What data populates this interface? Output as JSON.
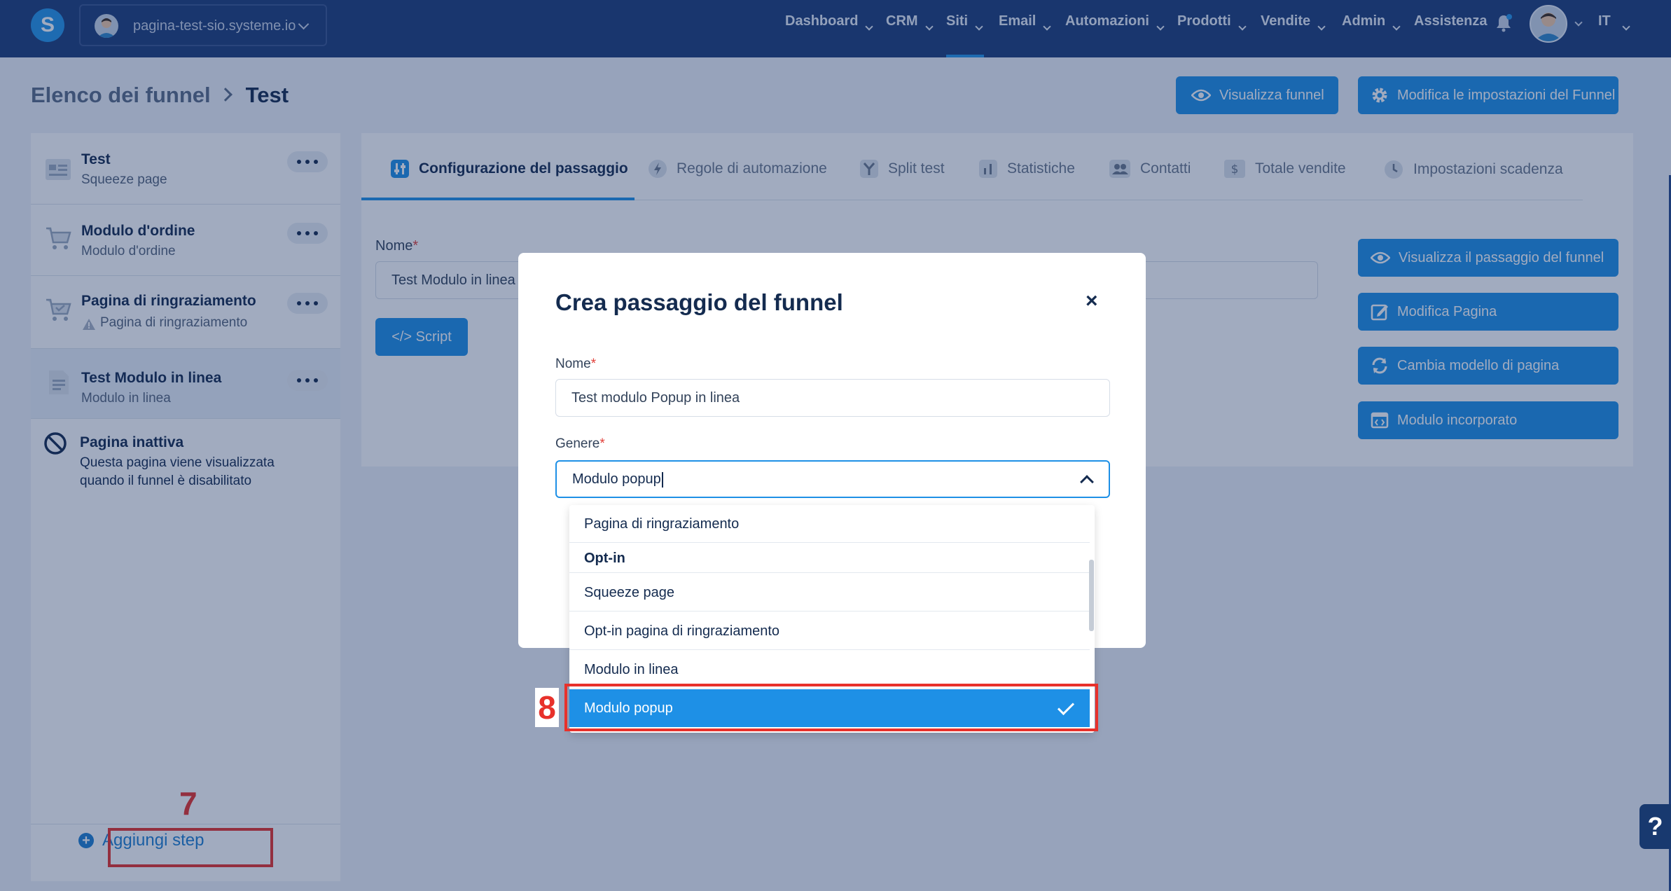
{
  "nav": {
    "logo": "S",
    "site_name": "pagina-test-sio.systeme.io",
    "menu": [
      {
        "label": "Dashboard"
      },
      {
        "label": "CRM"
      },
      {
        "label": "Siti"
      },
      {
        "label": "Email"
      },
      {
        "label": "Automazioni"
      },
      {
        "label": "Prodotti"
      },
      {
        "label": "Vendite"
      },
      {
        "label": "Admin"
      },
      {
        "label": "Assistenza"
      }
    ],
    "active_menu": "Siti",
    "language": "IT"
  },
  "header": {
    "breadcrumb_parent": "Elenco dei funnel",
    "breadcrumb_current": "Test",
    "view_funnel_label": "Visualizza funnel",
    "edit_settings_label": "Modifica le impostazioni del Funnel"
  },
  "sidebar": {
    "steps": [
      {
        "title": "Test",
        "subtitle": "Squeeze page",
        "icon": "squeeze-page-icon"
      },
      {
        "title": "Modulo d'ordine",
        "subtitle": "Modulo d'ordine",
        "icon": "cart-icon"
      },
      {
        "title": "Pagina di ringraziamento",
        "subtitle": "Pagina di ringraziamento",
        "icon": "cart-check-icon",
        "warning": true
      },
      {
        "title": "Test Modulo in linea",
        "subtitle": "Modulo in linea",
        "icon": "document-icon"
      }
    ],
    "inactive_title": "Pagina inattiva",
    "inactive_desc_line1": "Questa pagina viene visualizzata",
    "inactive_desc_line2": "quando il funnel è disabilitato",
    "add_step_label": "Aggiungi step"
  },
  "tabs": [
    {
      "label": "Configurazione del passaggio",
      "icon": "sliders-icon"
    },
    {
      "label": "Regole di automazione",
      "icon": "bolt-icon"
    },
    {
      "label": "Split test",
      "icon": "split-icon"
    },
    {
      "label": "Statistiche",
      "icon": "chart-icon"
    },
    {
      "label": "Contatti",
      "icon": "contacts-icon"
    },
    {
      "label": "Totale vendite",
      "icon": "dollar-icon"
    },
    {
      "label": "Impostazioni scadenza",
      "icon": "clock-icon"
    }
  ],
  "step_config": {
    "name_label": "Nome",
    "name_value": "Test Modulo in linea",
    "script_label": "</> Script"
  },
  "right_actions": [
    {
      "label": "Visualizza il passaggio del funnel",
      "icon": "eye-icon"
    },
    {
      "label": "Modifica Pagina",
      "icon": "edit-icon"
    },
    {
      "label": "Cambia modello di pagina",
      "icon": "refresh-icon"
    },
    {
      "label": "Modulo incorporato",
      "icon": "embed-icon"
    }
  ],
  "modal": {
    "title": "Crea passaggio del funnel",
    "close": "×",
    "name_label": "Nome",
    "name_value": "Test modulo Popup in linea",
    "genre_label": "Genere",
    "genre_value": "Modulo popup",
    "required_mark": "*"
  },
  "dropdown": {
    "items": [
      {
        "label": "Pagina di ringraziamento",
        "group": false
      },
      {
        "label": "Opt-in",
        "group": true
      },
      {
        "label": "Squeeze page",
        "group": false
      },
      {
        "label": "Opt-in pagina di ringraziamento",
        "group": false
      },
      {
        "label": "Modulo in linea",
        "group": false
      },
      {
        "label": "Modulo popup",
        "group": false,
        "selected": true
      }
    ]
  },
  "annotations": {
    "step7": "7",
    "step8": "8"
  },
  "help": "?",
  "colors": {
    "nav_bg": "#1d3c78",
    "accent": "#1e90e6",
    "annotation": "#e8312b"
  }
}
